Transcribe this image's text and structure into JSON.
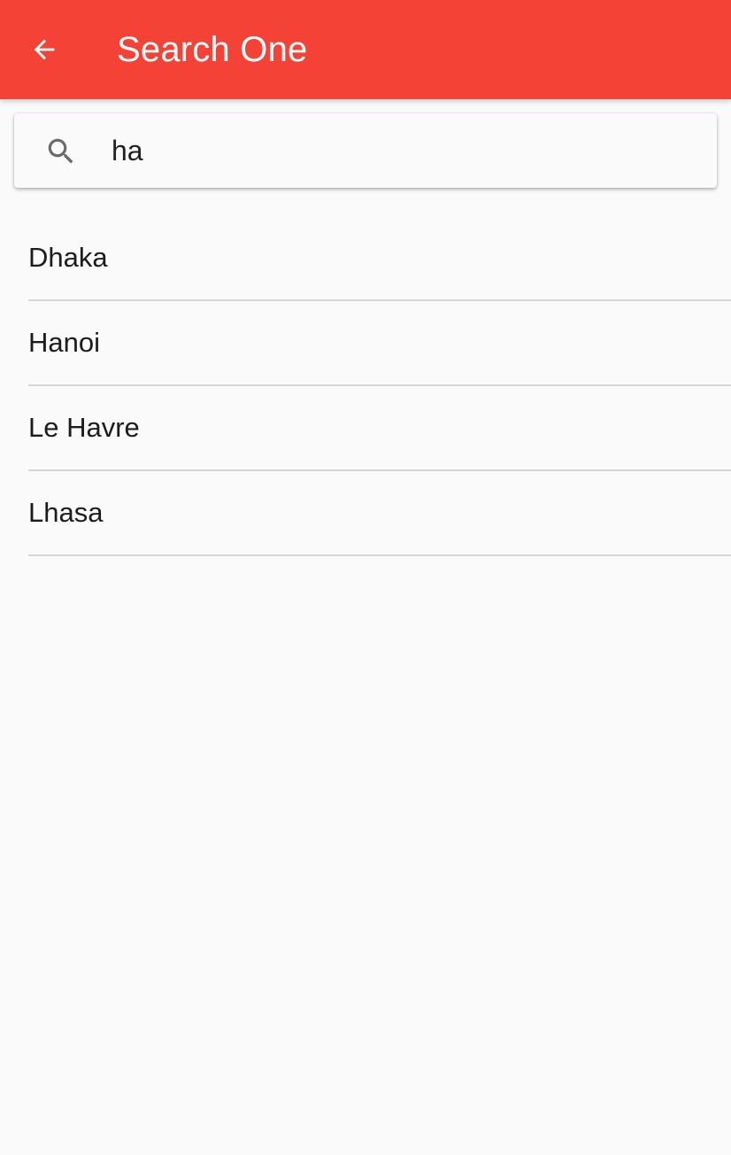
{
  "app_bar": {
    "title": "Search One",
    "back_icon": "arrow-back-icon",
    "background_color": "#f44336"
  },
  "search": {
    "icon": "search-icon",
    "value": "ha"
  },
  "results": [
    {
      "label": "Dhaka"
    },
    {
      "label": "Hanoi"
    },
    {
      "label": "Le Havre"
    },
    {
      "label": "Lhasa"
    }
  ]
}
